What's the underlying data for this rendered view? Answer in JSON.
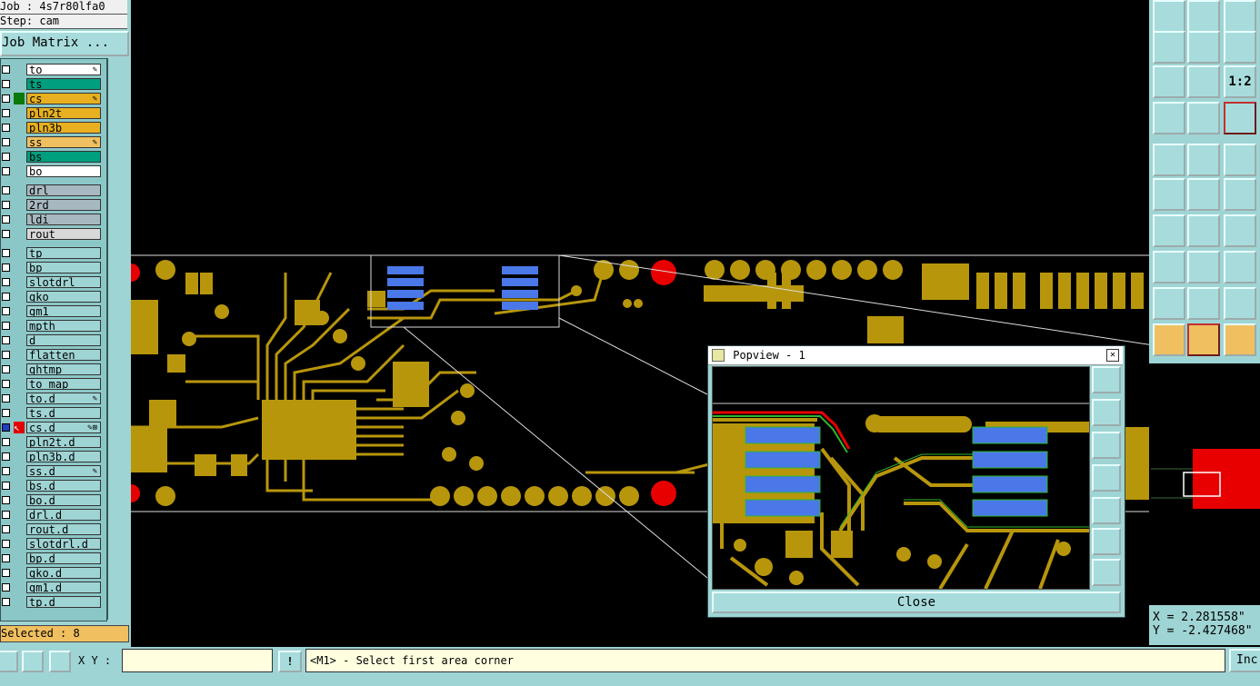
{
  "header": {
    "job": "Job : 4s7r80lfa0",
    "step": "Step: cam",
    "job_matrix_label": "Job Matrix ..."
  },
  "layers": [
    {
      "name": "to",
      "color": "#ffffff",
      "mark": "✎"
    },
    {
      "name": "ts",
      "color": "#009f7f",
      "mark": ""
    },
    {
      "name": "cs",
      "color": "#e8b020",
      "mark": "✎",
      "indicator": "#0a7a0a"
    },
    {
      "name": "pln2t",
      "color": "#e8b020",
      "mark": ""
    },
    {
      "name": "pln3b",
      "color": "#e8b020",
      "mark": ""
    },
    {
      "name": "ss",
      "color": "#f0c060",
      "mark": "✎"
    },
    {
      "name": "bs",
      "color": "#009f7f",
      "mark": ""
    },
    {
      "name": "bo",
      "color": "#ffffff",
      "mark": ""
    },
    {
      "name": "drl",
      "color": "#a8b8c0",
      "mark": ""
    },
    {
      "name": "2rd",
      "color": "#a8b8c0",
      "mark": ""
    },
    {
      "name": "ldi",
      "color": "#a8b8c0",
      "mark": ""
    },
    {
      "name": "rout",
      "color": "#d8d8d8",
      "mark": ""
    },
    {
      "name": "tp",
      "color": "#9fd4d4",
      "mark": ""
    },
    {
      "name": "bp",
      "color": "#9fd4d4",
      "mark": ""
    },
    {
      "name": "slotdrl",
      "color": "#9fd4d4",
      "mark": ""
    },
    {
      "name": "gko",
      "color": "#9fd4d4",
      "mark": ""
    },
    {
      "name": "gm1",
      "color": "#9fd4d4",
      "mark": ""
    },
    {
      "name": "mpth",
      "color": "#9fd4d4",
      "mark": ""
    },
    {
      "name": "d",
      "color": "#9fd4d4",
      "mark": ""
    },
    {
      "name": "flatten",
      "color": "#9fd4d4",
      "mark": ""
    },
    {
      "name": "ghtmp",
      "color": "#9fd4d4",
      "mark": ""
    },
    {
      "name": "to_map",
      "color": "#9fd4d4",
      "mark": ""
    },
    {
      "name": "to.d",
      "color": "#9fd4d4",
      "mark": "✎"
    },
    {
      "name": "ts.d",
      "color": "#9fd4d4",
      "mark": ""
    },
    {
      "name": "cs.d",
      "color": "#9fd4d4",
      "mark": "✎⊞",
      "indicator": "#e00000",
      "selected": true
    },
    {
      "name": "pln2t.d",
      "color": "#9fd4d4",
      "mark": ""
    },
    {
      "name": "pln3b.d",
      "color": "#9fd4d4",
      "mark": ""
    },
    {
      "name": "ss.d",
      "color": "#9fd4d4",
      "mark": "✎"
    },
    {
      "name": "bs.d",
      "color": "#9fd4d4",
      "mark": ""
    },
    {
      "name": "bo.d",
      "color": "#9fd4d4",
      "mark": ""
    },
    {
      "name": "drl.d",
      "color": "#9fd4d4",
      "mark": ""
    },
    {
      "name": "rout.d",
      "color": "#9fd4d4",
      "mark": ""
    },
    {
      "name": "slotdrl.d",
      "color": "#9fd4d4",
      "mark": ""
    },
    {
      "name": "bp.d",
      "color": "#9fd4d4",
      "mark": ""
    },
    {
      "name": "gko.d",
      "color": "#9fd4d4",
      "mark": ""
    },
    {
      "name": "gm1.d",
      "color": "#9fd4d4",
      "mark": ""
    },
    {
      "name": "tp.d",
      "color": "#9fd4d4",
      "mark": ""
    }
  ],
  "status": {
    "selected": "Selected : 8",
    "xy_label": "X Y :",
    "xy_value": "",
    "message": "<M1> - Select first area corner",
    "inc_label": "Inc"
  },
  "coords": {
    "x": "X = 2.281558\"",
    "y": "Y = -2.427468\""
  },
  "popview": {
    "title": "Popview - 1",
    "close_label": "Close",
    "close_x": "✕"
  },
  "toolbar_icons": [
    "clipboard-up-icon",
    "clipboard-down-icon",
    "home-icon",
    "pan-left-icon",
    "pan-right-icon",
    "zoom-back-icon",
    "fit-icon",
    "center-icon",
    "scale-1-2-icon",
    "tools-icon",
    "snap-icon",
    "drill-icon",
    "pad-icon",
    "line-icon",
    "ruler-icon",
    "connect-icon",
    "cross-icon",
    "node-icon",
    "angle-icon",
    "slash-icon",
    "arc-icon",
    "points-icon",
    "minus-icon",
    "bracket-icon",
    "triangle-a-icon",
    "triangle-b-icon",
    "triangle-c-icon",
    "select-cursor-icon",
    "select-cursor-red-icon",
    "select-cursor-box-icon"
  ],
  "toolbar_texts": {
    "scale": "1:2"
  },
  "colors": {
    "panel": "#9fd4d4",
    "copper": "#b8960c",
    "pad_blue": "#4a78e8",
    "drill_red": "#e80000",
    "message_bg": "#ffffe0"
  }
}
